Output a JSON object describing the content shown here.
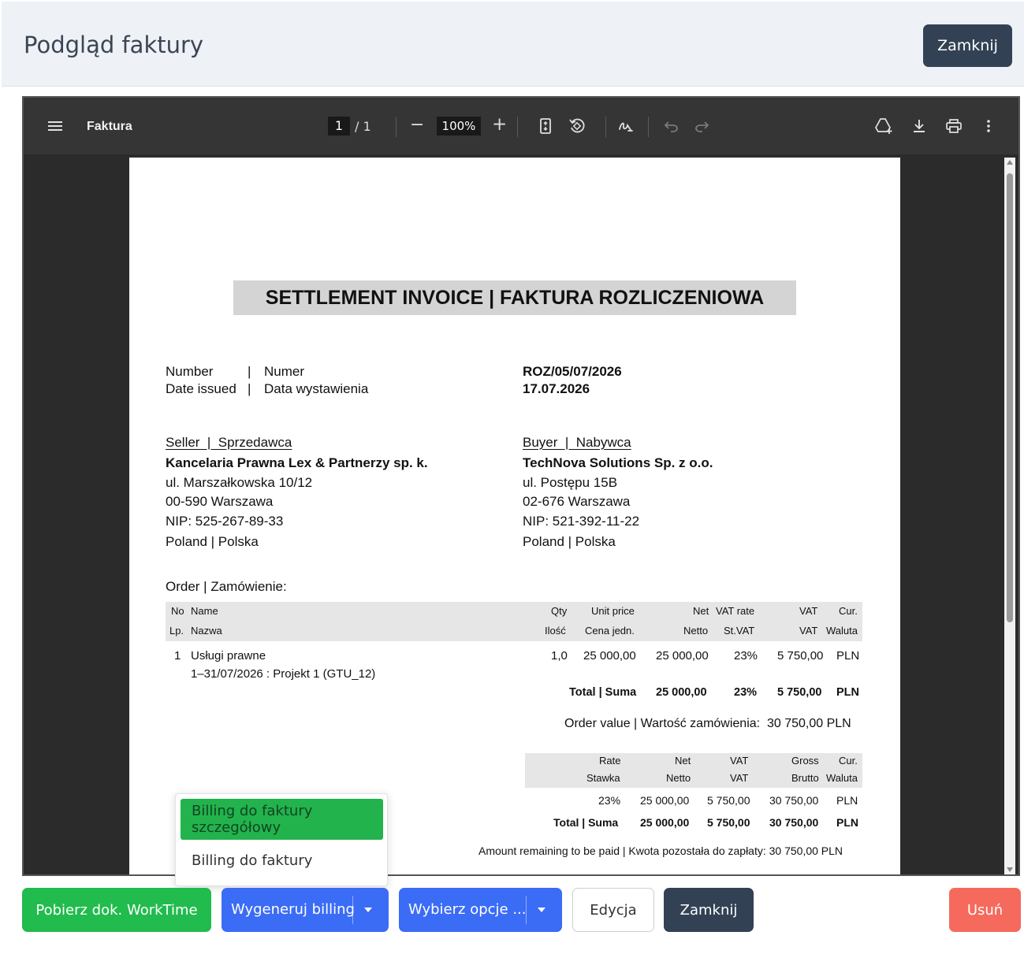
{
  "modal": {
    "title": "Podgląd faktury",
    "close_label": "Zamknij"
  },
  "viewer": {
    "doc_title": "Faktura",
    "page_current": "1",
    "page_total": "/ 1",
    "zoom": "100%",
    "zoom_out": "−",
    "zoom_in": "+"
  },
  "invoice": {
    "title": "SETTLEMENT INVOICE | FAKTURA ROZLICZENIOWA",
    "number_label_en": "Number",
    "number_label_sep": "|",
    "number_label_pl": "Numer",
    "date_label_en": "Date issued",
    "date_label_pl": "Data wystawienia",
    "number": "ROZ/05/07/2026",
    "date": "17.07.2026",
    "seller": {
      "heading": "Seller  |  Sprzedawca",
      "name": "Kancelaria Prawna Lex & Partnerzy sp. k.",
      "street": "ul. Marszałkowska 10/12",
      "city": "00-590 Warszawa",
      "nip": "NIP: 525-267-89-33",
      "country": "Poland | Polska"
    },
    "buyer": {
      "heading": "Buyer  |  Nabywca",
      "name": "TechNova Solutions Sp. z o.o.",
      "street": "ul. Postępu 15B",
      "city": "02-676 Warszawa",
      "nip": "NIP: 521-392-11-22",
      "country": "Poland | Polska"
    },
    "order_heading": "Order | Zamówienie:",
    "order_table": {
      "headers_en": [
        "No",
        "Name",
        "Qty",
        "Unit price",
        "Net",
        "VAT rate",
        "VAT",
        "Cur."
      ],
      "headers_pl": [
        "Lp.",
        "Nazwa",
        "Ilość",
        "Cena jedn.",
        "Netto",
        "St.VAT",
        "VAT",
        "Waluta"
      ],
      "row": {
        "no": "1",
        "name": "Usługi prawne",
        "desc": "1–31/07/2026 : Projekt 1 (GTU_12)",
        "qty": "1,0",
        "unit_price": "25 000,00",
        "net": "25 000,00",
        "rate": "23%",
        "vat": "5 750,00",
        "cur": "PLN"
      },
      "total": {
        "label": "Total | Suma",
        "net": "25 000,00",
        "rate": "23%",
        "vat": "5 750,00",
        "cur": "PLN"
      }
    },
    "order_value": "Order value | Wartość zamówienia:  30 750,00 PLN",
    "vat_table": {
      "headers_en": [
        "Rate",
        "Net",
        "VAT",
        "Gross",
        "Cur."
      ],
      "headers_pl": [
        "Stawka",
        "Netto",
        "VAT",
        "Brutto",
        "Waluta"
      ],
      "row": {
        "rate": "23%",
        "net": "25 000,00",
        "vat": "5 750,00",
        "gross": "30 750,00",
        "cur": "PLN"
      },
      "total": {
        "label": "Total | Suma",
        "net": "25 000,00",
        "vat": "5 750,00",
        "gross": "30 750,00",
        "cur": "PLN"
      }
    },
    "remaining": "Amount remaining to be paid | Kwota pozostała do zapłaty: 30 750,00 PLN"
  },
  "dropdown": {
    "items": [
      "Billing do faktury szczegółowy",
      "Billing do faktury"
    ]
  },
  "footer": {
    "download_worktime": "Pobierz dok. WorkTime",
    "generate_billing": "Wygeneruj billing",
    "choose_options": "Wybierz opcje ...",
    "edit": "Edycja",
    "close": "Zamknij",
    "delete": "Usuń"
  },
  "colors": {
    "green": "#22bb4e",
    "blue": "#3b6cf6",
    "dark": "#334155",
    "red": "#f56a5c"
  }
}
